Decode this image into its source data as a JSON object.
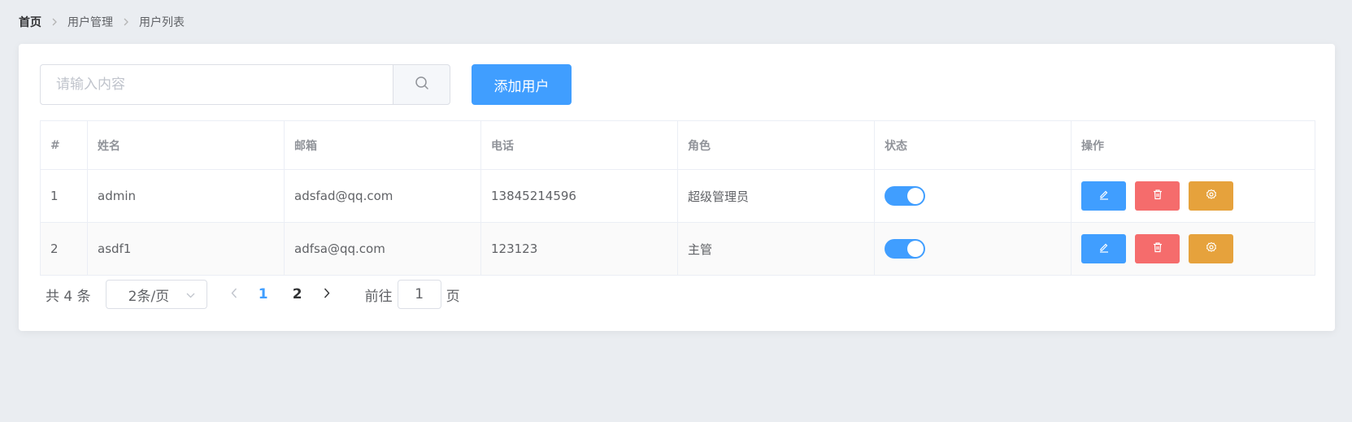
{
  "breadcrumb": [
    "首页",
    "用户管理",
    "用户列表"
  ],
  "search": {
    "placeholder": "请输入内容",
    "value": ""
  },
  "add_button": "添加用户",
  "table": {
    "headers": [
      "#",
      "姓名",
      "邮箱",
      "电话",
      "角色",
      "状态",
      "操作"
    ],
    "rows": [
      {
        "index": "1",
        "name": "admin",
        "email": "adsfad@qq.com",
        "phone": "13845214596",
        "role": "超级管理员",
        "status_on": true
      },
      {
        "index": "2",
        "name": "asdf1",
        "email": "adfsa@qq.com",
        "phone": "123123",
        "role": "主管",
        "status_on": true
      }
    ]
  },
  "pagination": {
    "total_text": "共 4 条",
    "page_size": "2条/页",
    "pages": [
      "1",
      "2"
    ],
    "current_page": "1",
    "goto_prefix": "前往",
    "goto_value": "1",
    "goto_suffix": "页"
  },
  "colors": {
    "primary": "#409eff",
    "danger": "#f56c6c",
    "warning": "#e6a23c",
    "background": "#eaedf1"
  },
  "icons": {
    "search": "search-icon",
    "edit": "edit-icon",
    "delete": "delete-icon",
    "settings": "settings-icon",
    "arrow-left": "chevron-left-icon",
    "arrow-right": "chevron-right-icon"
  }
}
